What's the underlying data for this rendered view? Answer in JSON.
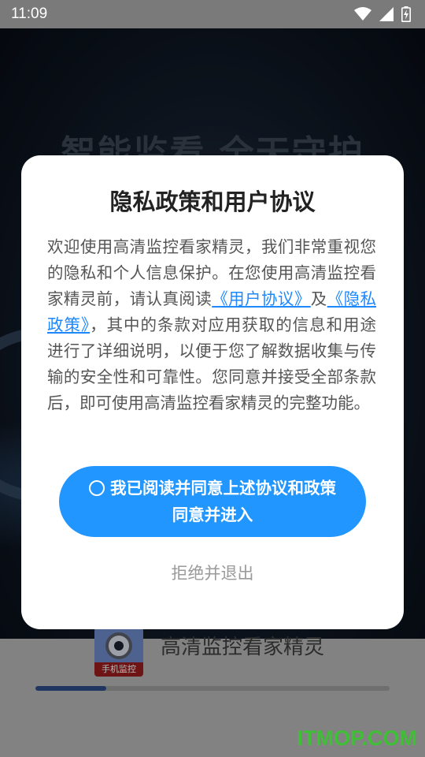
{
  "status_bar": {
    "time": "11:09",
    "icons": [
      "wifi-icon",
      "signal-icon",
      "battery-charging-icon"
    ]
  },
  "background": {
    "slogan": "智能监看 全天守护",
    "app_logo_label": "手机监控",
    "app_name": "高清监控看家精灵",
    "loading_progress": 0.2
  },
  "dialog": {
    "title": "隐私政策和用户协议",
    "body_intro": "欢迎使用高清监控看家精灵，我们非常重视您的隐私和个人信息保护。在您使用高清监控看家精灵前，请认真阅读",
    "user_agreement_link": "《用户协议》",
    "and_text": "及",
    "privacy_policy_link": "《隐私政策》",
    "body_rest": "，其中的条款对应用获取的信息和用途进行了详细说明，以便于您了解数据收集与传输的安全性和可靠性。您同意并接受全部条款后，即可使用高清监控看家精灵的完整功能。",
    "agree_checkbox_label": "我已阅读并同意上述协议和政策",
    "agree_button_label": "同意并进入",
    "reject_button_label": "拒绝并退出"
  },
  "watermark": "ITMOP.COM",
  "colors": {
    "accent": "#2196ff",
    "link": "#1e88ff",
    "watermark": "#3fbf35",
    "progress": "#2c4d86"
  }
}
